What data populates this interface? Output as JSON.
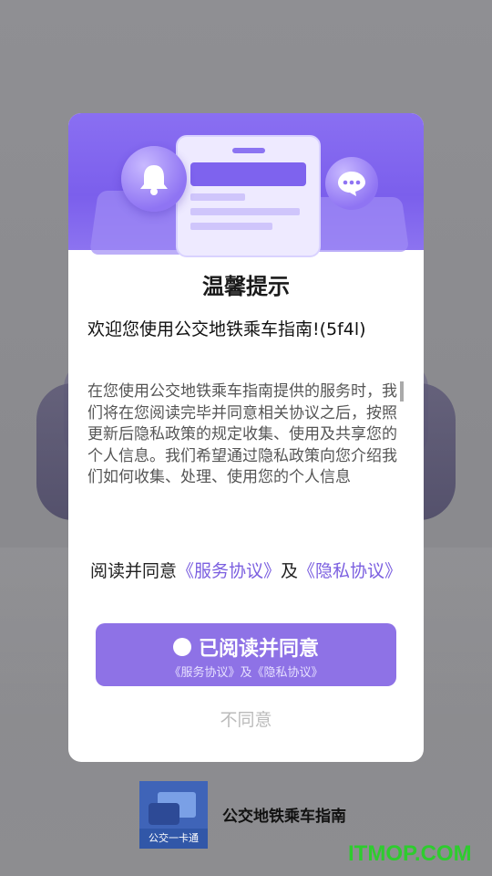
{
  "dialog": {
    "title": "温馨提示",
    "welcome": "欢迎您使用公交地铁乘车指南!(5f4l)",
    "body": "在您使用公交地铁乘车指南提供的服务时，我们将在您阅读完毕并同意相关协议之后，按照更新后隐私政策的规定收集、使用及共享您的个人信息。我们希望通过隐私政策向您介绍我们如何收集、处理、使用您的个人信息",
    "agree_prefix": "阅读并同意",
    "service_link": "《服务协议》",
    "conjunction": "及",
    "privacy_link": "《隐私协议》",
    "accept_label": "已阅读并同意",
    "accept_sub": "《服务协议》及《隐私协议》",
    "decline_label": "不同意"
  },
  "app": {
    "name": "公交地铁乘车指南",
    "icon_text": "公交一卡通"
  },
  "watermark": "ITMOP.COM",
  "colors": {
    "accent": "#8e72e6",
    "link": "#7b5fe0",
    "banner": "#7b5fec",
    "watermark": "#2ecc2e"
  }
}
